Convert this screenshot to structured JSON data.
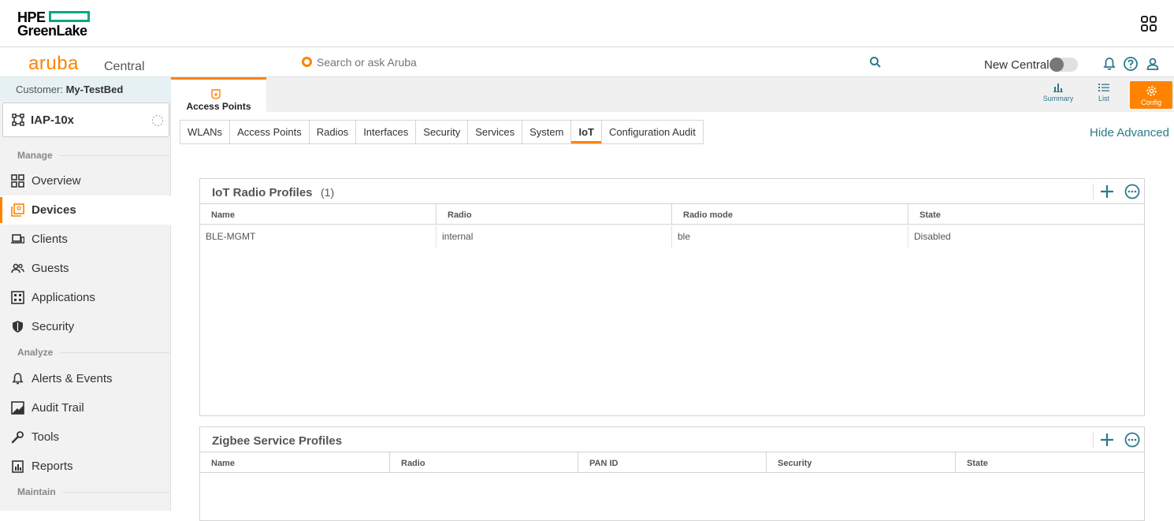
{
  "brand": {
    "hpe_line1": "HPE",
    "hpe_line2": "GreenLake",
    "aruba": "aruba",
    "product": "Central",
    "accent": "#ff8300",
    "hpe_green": "#01a982"
  },
  "search": {
    "placeholder": "Search or ask Aruba"
  },
  "header": {
    "new_central_label": "New Central",
    "new_central_enabled": false
  },
  "sidebar": {
    "customer_label": "Customer:",
    "customer_name": "My-TestBed",
    "device_name": "IAP-10x",
    "groups": {
      "manage": "Manage",
      "analyze": "Analyze",
      "maintain": "Maintain"
    },
    "items": [
      {
        "label": "Overview",
        "icon": "grid-icon"
      },
      {
        "label": "Devices",
        "icon": "devices-icon",
        "active": true
      },
      {
        "label": "Clients",
        "icon": "laptop-icon"
      },
      {
        "label": "Guests",
        "icon": "guests-icon"
      },
      {
        "label": "Applications",
        "icon": "apps-icon"
      },
      {
        "label": "Security",
        "icon": "shield-icon"
      },
      {
        "label": "Alerts & Events",
        "icon": "bell-icon"
      },
      {
        "label": "Audit Trail",
        "icon": "audit-icon"
      },
      {
        "label": "Tools",
        "icon": "wrench-icon"
      },
      {
        "label": "Reports",
        "icon": "report-icon"
      }
    ]
  },
  "device_tab": {
    "label": "Access Points"
  },
  "views": {
    "summary": "Summary",
    "list": "List",
    "config": "Config"
  },
  "subtabs": [
    "WLANs",
    "Access Points",
    "Radios",
    "Interfaces",
    "Security",
    "Services",
    "System",
    "IoT",
    "Configuration Audit"
  ],
  "active_subtab": "IoT",
  "hide_advanced": "Hide Advanced",
  "iot_panel": {
    "title": "IoT Radio Profiles",
    "count": "(1)",
    "columns": [
      "Name",
      "Radio",
      "Radio mode",
      "State"
    ],
    "rows": [
      [
        "BLE-MGMT",
        "internal",
        "ble",
        "Disabled"
      ]
    ]
  },
  "zigbee_panel": {
    "title": "Zigbee Service Profiles",
    "columns": [
      "Name",
      "Radio",
      "PAN ID",
      "Security",
      "State"
    ]
  }
}
